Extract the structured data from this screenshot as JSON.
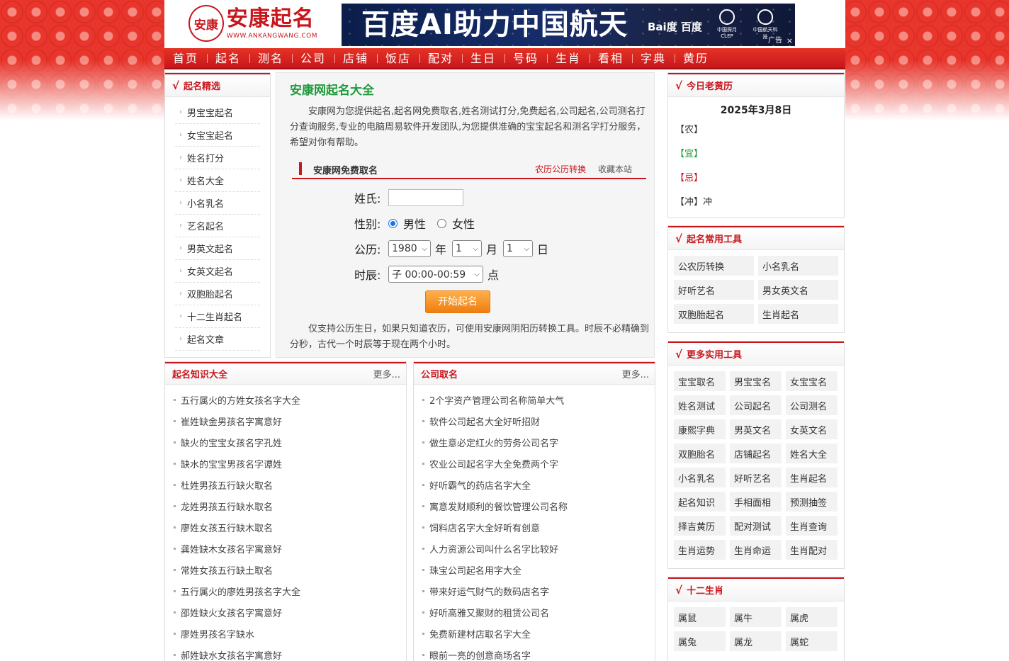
{
  "logo": {
    "seal": "安康",
    "name": "安康起名",
    "url": "WWW.ANKANGWANG.COM"
  },
  "ad": {
    "title": "百度AI助力中国航天",
    "brand": "Bai度 百度",
    "org1": "中国探月 CLEP",
    "org2": "中国航天科技",
    "tag": "广告",
    "close": "×"
  },
  "nav": [
    "首页",
    "起名",
    "测名",
    "公司",
    "店铺",
    "饭店",
    "配对",
    "生日",
    "号码",
    "生肖",
    "看相",
    "字典",
    "黄历"
  ],
  "left": {
    "title": "起名精选",
    "check": "√",
    "items": [
      "男宝宝起名",
      "女宝宝起名",
      "姓名打分",
      "姓名大全",
      "小名乳名",
      "艺名起名",
      "男英文起名",
      "女英文起名",
      "双胞胎起名",
      "十二生肖起名",
      "起名文章"
    ]
  },
  "center": {
    "title": "安康网起名大全",
    "intro": "安康网为您提供起名,起名网免费取名,姓名测试打分,免费起名,公司起名,公司测名打分查询服务,专业的电脑周易软件开发团队,为您提供准确的宝宝起名和测名字打分服务，希望对你有帮助。",
    "sub_title": "安康网免费取名",
    "link_convert": "农历公历转换",
    "link_fav": "收藏本站",
    "form": {
      "surname_label": "姓氏:",
      "surname_value": "",
      "gender_label": "性别:",
      "male": "男性",
      "female": "女性",
      "date_label": "公历:",
      "year": "1980",
      "year_unit": "年",
      "month": "1",
      "month_unit": "月",
      "day": "1",
      "day_unit": "日",
      "hour_label": "时辰:",
      "hour": "子 00:00-00:59",
      "hour_unit": "点",
      "submit": "开始起名"
    },
    "note": "仅支持公历生日，如果只知道农历，可使用安康网阴阳历转换工具。时辰不必精确到分秒，古代一个时辰等于现在两个小时。"
  },
  "almanac": {
    "title": "今日老黄历",
    "date": "2025年3月8日",
    "rows": [
      {
        "label": "【农】",
        "value": "",
        "color": "#333333"
      },
      {
        "label": "【宜】",
        "value": "",
        "color": "#1f9a3a"
      },
      {
        "label": "【忌】",
        "value": "",
        "color": "#c8161d"
      },
      {
        "label": "【冲】",
        "value": "冲",
        "color": "#333333"
      }
    ]
  },
  "common_tools": {
    "title": "起名常用工具",
    "items": [
      "公农历转换",
      "小名乳名",
      "好听艺名",
      "男女英文名",
      "双胞胎起名",
      "生肖起名"
    ]
  },
  "more_tools": {
    "title": "更多实用工具",
    "items": [
      "宝宝取名",
      "男宝宝名",
      "女宝宝名",
      "姓名测试",
      "公司起名",
      "公司测名",
      "康熙字典",
      "男英文名",
      "女英文名",
      "双胞胎名",
      "店铺起名",
      "姓名大全",
      "小名乳名",
      "好听艺名",
      "生肖起名",
      "起名知识",
      "手相面相",
      "预测抽签",
      "择吉黄历",
      "配对测试",
      "生肖查询",
      "生肖运势",
      "生肖命运",
      "生肖配对"
    ]
  },
  "zodiac": {
    "title": "十二生肖",
    "items": [
      "属鼠",
      "属牛",
      "属虎",
      "属兔",
      "属龙",
      "属蛇"
    ]
  },
  "knowledge": {
    "title": "起名知识大全",
    "more": "更多...",
    "items": [
      "五行属火的方姓女孩名字大全",
      "崔姓缺金男孩名字寓意好",
      "缺火的宝宝女孩名字孔姓",
      "缺水的宝宝男孩名字谭姓",
      "杜姓男孩五行缺火取名",
      "龙姓男孩五行缺水取名",
      "廖姓女孩五行缺木取名",
      "龚姓缺木女孩名字寓意好",
      "常姓女孩五行缺土取名",
      "五行属火的廖姓男孩名字大全",
      "邵姓缺火女孩名字寓意好",
      "廖姓男孩名字缺水",
      "郝姓缺水女孩名字寓意好"
    ]
  },
  "company": {
    "title": "公司取名",
    "more": "更多...",
    "items": [
      "2个字资产管理公司名称简单大气",
      "软件公司起名大全好听招财",
      "做生意必定红火的劳务公司名字",
      "农业公司起名字大全免费两个字",
      "好听霸气的药店名字大全",
      "寓意发财顺利的餐饮管理公司名称",
      "饲料店名字大全好听有创意",
      "人力资源公司叫什么名字比较好",
      "珠宝公司起名用字大全",
      "带来好运气财气的数码店名字",
      "好听高雅又聚财的租赁公司名",
      "免费新建材店取名字大全",
      "眼前一亮的创意商场名字"
    ]
  }
}
